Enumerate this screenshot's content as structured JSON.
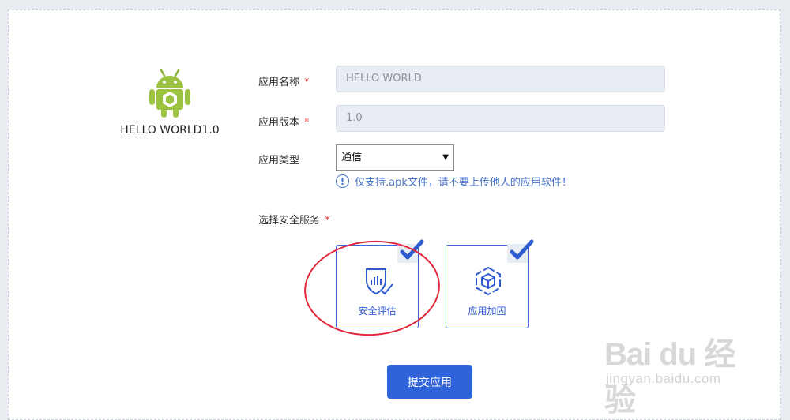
{
  "app": {
    "caption": "HELLO WORLD1.0",
    "icon": "android-icon"
  },
  "form": {
    "name_label": "应用名称",
    "name_value": "HELLO WORLD",
    "version_label": "应用版本",
    "version_value": "1.0",
    "type_label": "应用类型",
    "type_selected": "通信",
    "required_mark": "*",
    "hint_text": "仅支持.apk文件，请不要上传他人的应用软件！",
    "hint_icon": "info-icon"
  },
  "services": {
    "section_label": "选择安全服务",
    "items": [
      {
        "label": "安全评估",
        "icon": "shield-chart-icon",
        "checked": true
      },
      {
        "label": "应用加固",
        "icon": "hexagon-cube-icon",
        "checked": true
      }
    ]
  },
  "submit_label": "提交应用",
  "watermark": {
    "logo": "Bai du 经验",
    "url": "jingyan.baidu.com"
  },
  "colors": {
    "accent": "#2f63d9",
    "required": "#e0403a",
    "highlight": "#e0283a",
    "hint": "#4a74c8",
    "field_bg": "#e8ecf3"
  }
}
